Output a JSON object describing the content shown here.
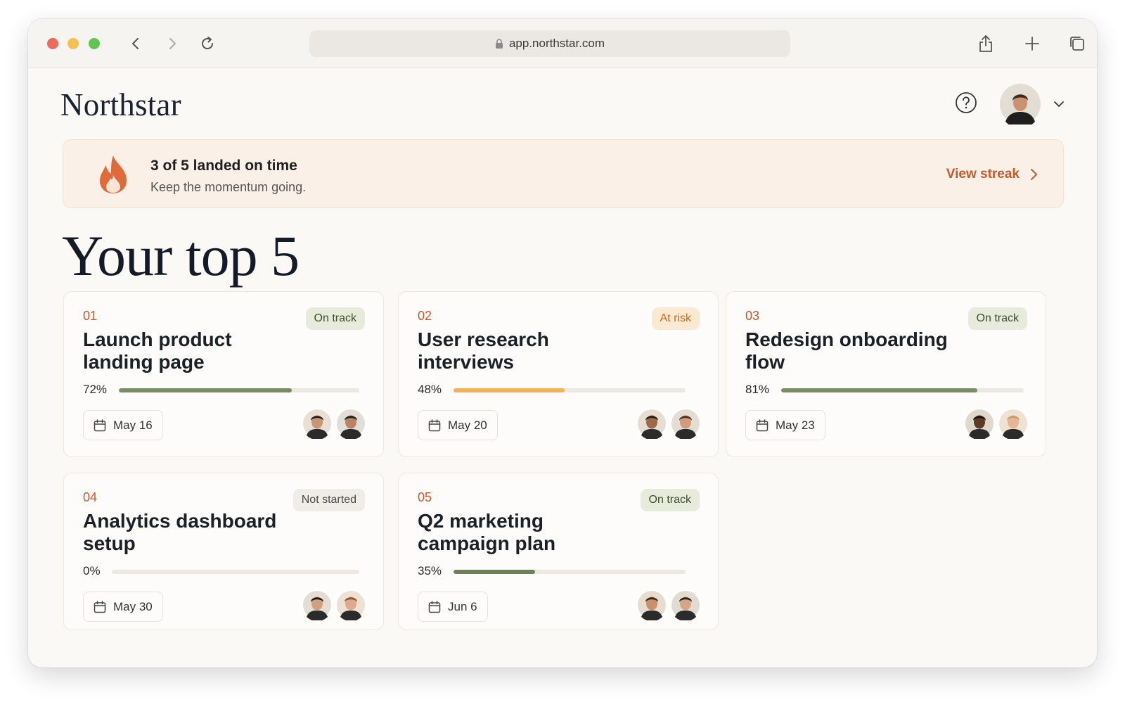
{
  "browser": {
    "url": "app.northstar.com"
  },
  "app": {
    "logo": "Northstar"
  },
  "banner": {
    "title": "3 of 5 landed on time",
    "subtitle": "Keep the momentum going.",
    "link": "View streak"
  },
  "heading": "Your top 5",
  "cards": [
    {
      "num": "01",
      "title": "Launch product landing page",
      "status": "On track",
      "status_kind": "on",
      "progress_label": "72%",
      "progress": 0.72,
      "date": "May 16",
      "bar_color": "#7a8c63"
    },
    {
      "num": "02",
      "title": "User research interviews",
      "status": "At risk",
      "status_kind": "risk",
      "progress_label": "48%",
      "progress": 0.48,
      "date": "May 20",
      "bar_color": "#f0b35a"
    },
    {
      "num": "03",
      "title": "Redesign onboarding flow",
      "status": "On track",
      "status_kind": "on",
      "progress_label": "81%",
      "progress": 0.81,
      "date": "May 23",
      "bar_color": "#7a8c63"
    },
    {
      "num": "04",
      "title": "Analytics dashboard setup",
      "status": "Not started",
      "status_kind": "none",
      "progress_label": "0%",
      "progress": 0,
      "date": "May 30",
      "bar_color": "#7a8c63"
    },
    {
      "num": "05",
      "title": "Q2 marketing campaign plan",
      "status": "On track",
      "status_kind": "on",
      "progress_label": "35%",
      "progress": 0.35,
      "date": "Jun 6",
      "bar_color": "#6f8058"
    }
  ],
  "colors": {
    "accent": "#c9592c",
    "on_track": "#7a8c63",
    "at_risk": "#f0b35a"
  }
}
